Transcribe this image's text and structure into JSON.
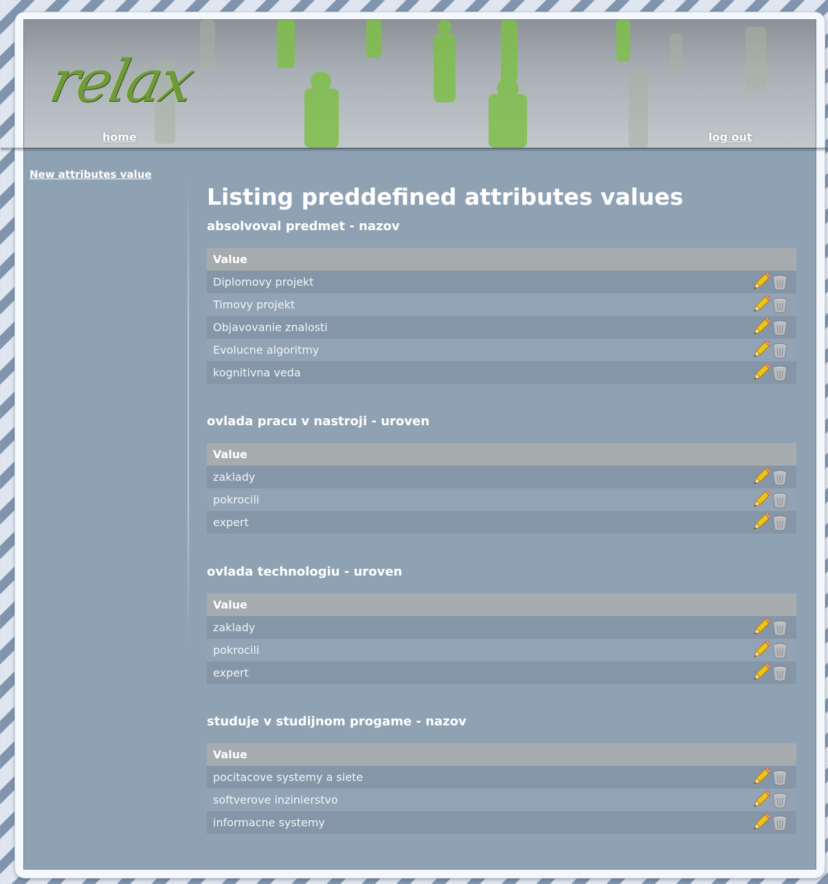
{
  "header": {
    "logo_text": "relax",
    "home_label": "home",
    "logout_label": "log out"
  },
  "sidebar": {
    "new_link": "New attributes value"
  },
  "main": {
    "title": "Listing preddefined attributes values",
    "sections": [
      {
        "title": "absolvoval predmet - nazov",
        "column": "Value",
        "rows": [
          "Diplomovy projekt",
          "Timovy projekt",
          "Objavovanie znalosti",
          "Evolucne algoritmy",
          "kognitivna veda"
        ]
      },
      {
        "title": "ovlada pracu v nastroji - uroven",
        "column": "Value",
        "rows": [
          "zaklady",
          "pokrocili",
          "expert"
        ]
      },
      {
        "title": "ovlada technologiu - uroven",
        "column": "Value",
        "rows": [
          "zaklady",
          "pokrocili",
          "expert"
        ]
      },
      {
        "title": "studuje v studijnom progame - nazov",
        "column": "Value",
        "rows": [
          "pocitacove systemy a siete",
          "softverove inzinierstvo",
          "informacne systemy"
        ]
      }
    ]
  },
  "icons": {
    "edit": "pencil-icon",
    "delete": "trash-icon"
  },
  "colors": {
    "panel": "#8fa2b4",
    "header_row": "#a6abae",
    "row_dark": "#8496a8",
    "row_light": "#91a3b5",
    "logo_green": "#6f9a39"
  }
}
